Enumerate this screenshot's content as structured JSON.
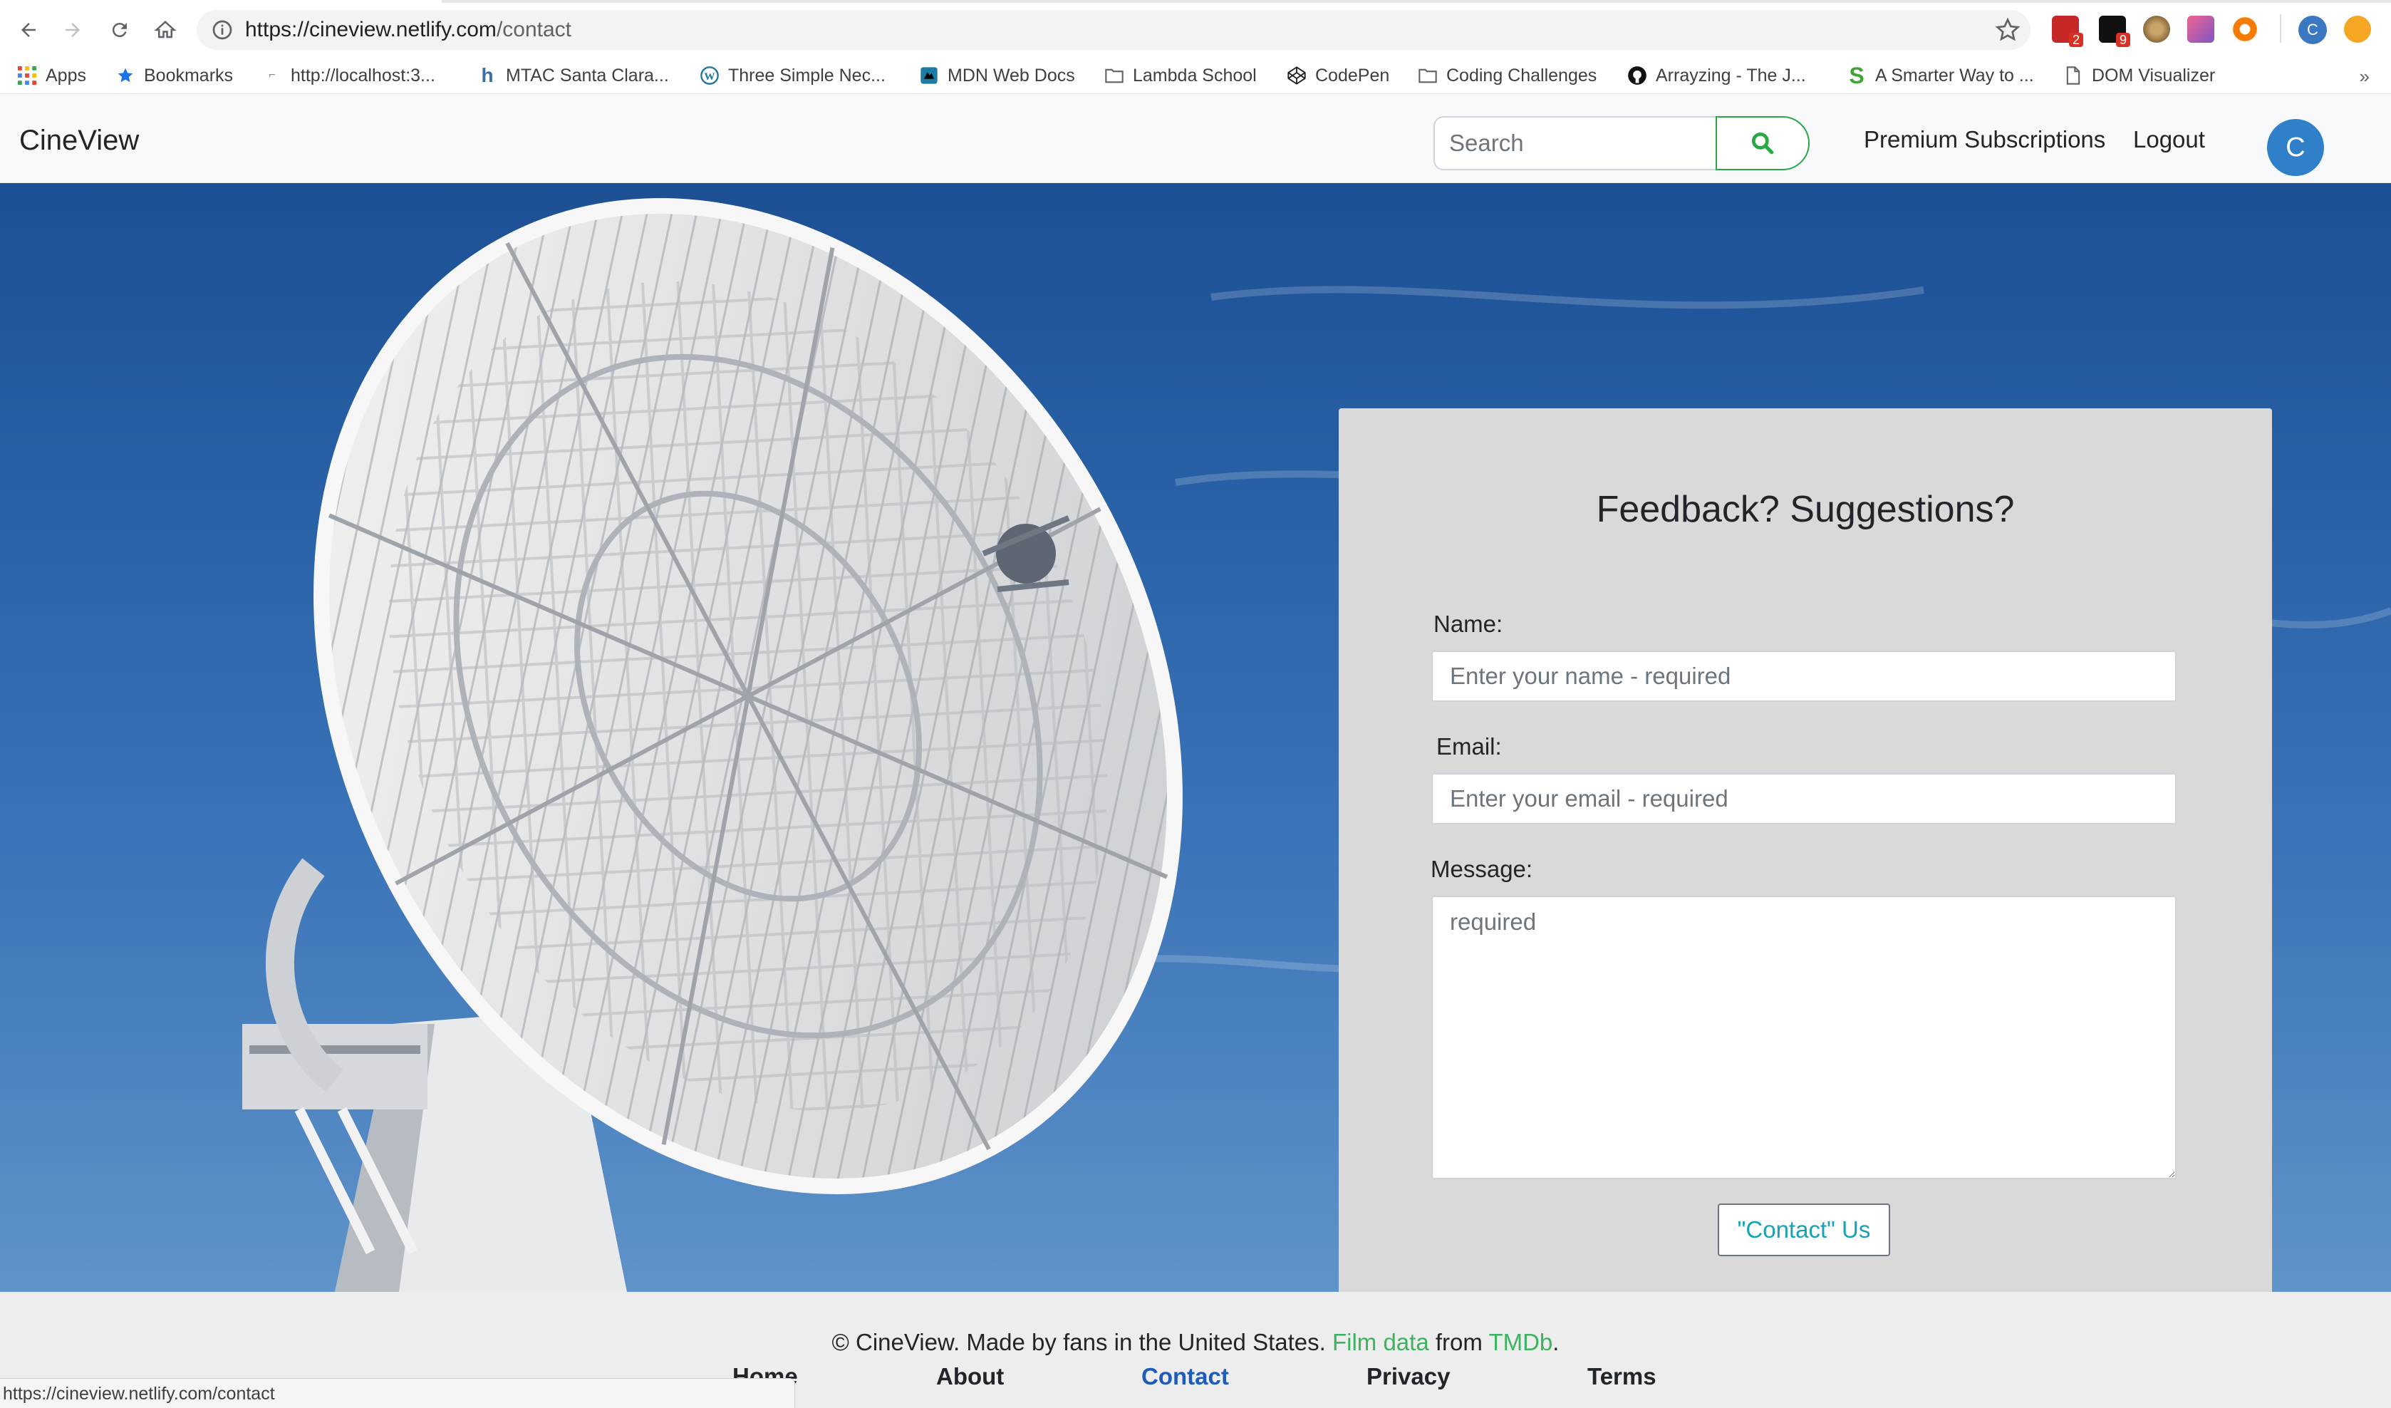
{
  "browser": {
    "url_host": "https://cineview.netlify.com",
    "url_path": "/contact",
    "profile_initial": "C",
    "ext_badges": [
      "2",
      "9"
    ],
    "bookmarks": [
      {
        "label": "Apps",
        "icon": "apps-grid-icon"
      },
      {
        "label": "Bookmarks",
        "icon": "star-icon"
      },
      {
        "label": "http://localhost:3...",
        "icon": "localhost-icon"
      },
      {
        "label": "MTAC Santa Clara...",
        "icon": "mtac-icon"
      },
      {
        "label": "Three Simple Nec...",
        "icon": "wordpress-icon"
      },
      {
        "label": "MDN Web Docs",
        "icon": "mdn-icon"
      },
      {
        "label": "Lambda School",
        "icon": "folder-icon"
      },
      {
        "label": "CodePen",
        "icon": "codepen-icon"
      },
      {
        "label": "Coding Challenges",
        "icon": "folder-icon"
      },
      {
        "label": "Arrayzing - The J...",
        "icon": "github-icon"
      },
      {
        "label": "A Smarter Way to ...",
        "icon": "s-logo-icon"
      },
      {
        "label": "DOM Visualizer",
        "icon": "page-icon"
      }
    ],
    "more_label": "»",
    "status_url": "https://cineview.netlify.com/contact"
  },
  "navbar": {
    "brand": "CineView",
    "search_placeholder": "Search",
    "premium_label": "Premium Subscriptions",
    "logout_label": "Logout",
    "avatar_initial": "C"
  },
  "form": {
    "title": "Feedback? Suggestions?",
    "name_label": "Name:",
    "name_placeholder": "Enter your name - required",
    "email_label": "Email:",
    "email_placeholder": "Enter your email - required",
    "message_label": "Message:",
    "message_placeholder": "required",
    "submit_label": "\"Contact\" Us"
  },
  "footer": {
    "copyright": "© CineView. Made by fans in the United States.",
    "film_data_link": "Film data",
    "from_text": "from",
    "tmdb_link": "TMDb",
    "period": ".",
    "links": [
      "Home",
      "About",
      "Contact",
      "Privacy",
      "Terms"
    ]
  },
  "colors": {
    "accent_green": "#28a745",
    "link_green": "#3bb35f",
    "active_blue": "#1f5bb8",
    "submit_text": "#17a2b8",
    "sky_blue": "#2a62a7"
  }
}
